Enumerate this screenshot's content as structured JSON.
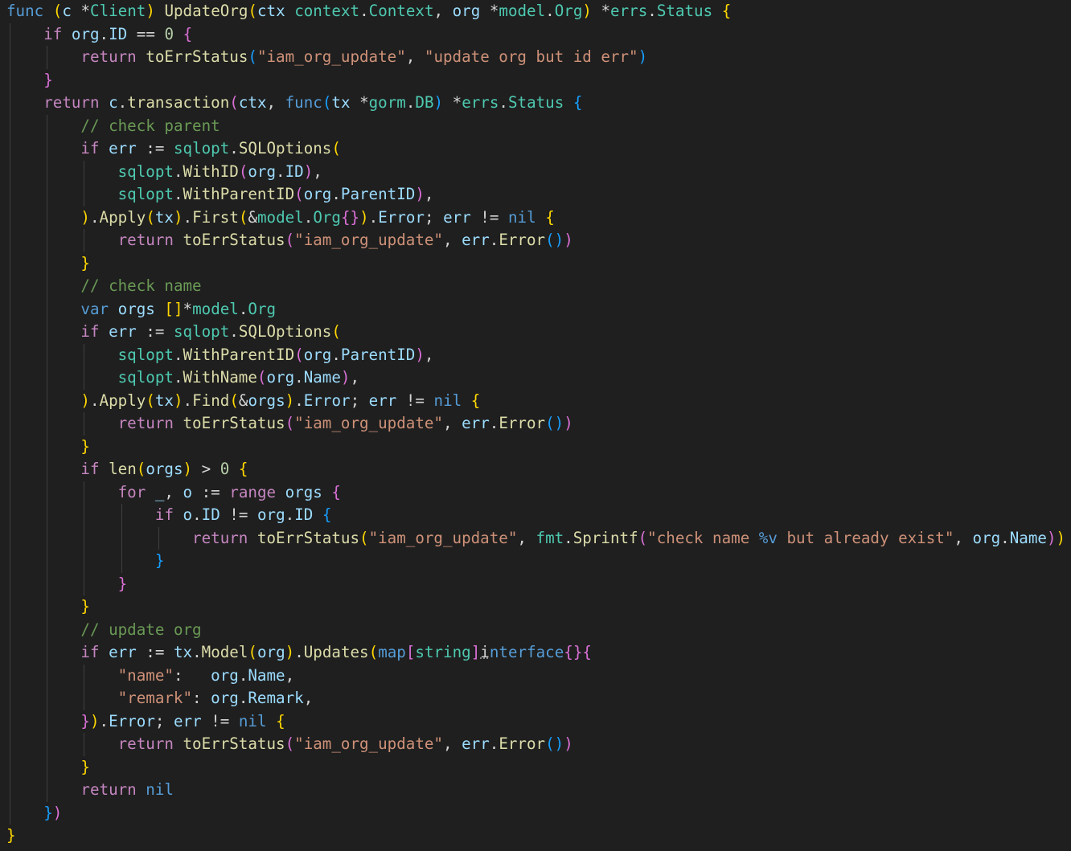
{
  "colors": {
    "background": "#1f1f1f",
    "keyword": "#569cd6",
    "control": "#c586c0",
    "function": "#dcdcaa",
    "type": "#4ec9b0",
    "variable": "#9cdcfe",
    "string": "#ce9178",
    "number": "#b5cea8",
    "comment": "#6a9955",
    "bracket_level_1": "#ffd700",
    "bracket_level_2": "#da70d6",
    "bracket_level_3": "#179fff"
  },
  "code_lines": [
    [
      [
        "kw",
        "func"
      ],
      [
        "op",
        " "
      ],
      [
        "b1",
        "("
      ],
      [
        "var",
        "c"
      ],
      [
        "op",
        " *"
      ],
      [
        "type",
        "Client"
      ],
      [
        "b1",
        ")"
      ],
      [
        "op",
        " "
      ],
      [
        "fn",
        "UpdateOrg"
      ],
      [
        "b1",
        "("
      ],
      [
        "var",
        "ctx"
      ],
      [
        "op",
        " "
      ],
      [
        "type",
        "context"
      ],
      [
        "op",
        "."
      ],
      [
        "type",
        "Context"
      ],
      [
        "op",
        ", "
      ],
      [
        "var",
        "org"
      ],
      [
        "op",
        " *"
      ],
      [
        "type",
        "model"
      ],
      [
        "op",
        "."
      ],
      [
        "type",
        "Org"
      ],
      [
        "b1",
        ")"
      ],
      [
        "op",
        " *"
      ],
      [
        "type",
        "errs"
      ],
      [
        "op",
        "."
      ],
      [
        "type",
        "Status"
      ],
      [
        "op",
        " "
      ],
      [
        "b1",
        "{"
      ]
    ],
    [
      [
        "op",
        "    "
      ],
      [
        "ctrl",
        "if"
      ],
      [
        "op",
        " "
      ],
      [
        "var",
        "org"
      ],
      [
        "op",
        "."
      ],
      [
        "var",
        "ID"
      ],
      [
        "op",
        " == "
      ],
      [
        "num",
        "0"
      ],
      [
        "op",
        " "
      ],
      [
        "b2",
        "{"
      ]
    ],
    [
      [
        "op",
        "        "
      ],
      [
        "ctrl",
        "return"
      ],
      [
        "op",
        " "
      ],
      [
        "fn",
        "toErrStatus"
      ],
      [
        "b3",
        "("
      ],
      [
        "str",
        "\"iam_org_update\""
      ],
      [
        "op",
        ", "
      ],
      [
        "str",
        "\"update org but id err\""
      ],
      [
        "b3",
        ")"
      ]
    ],
    [
      [
        "op",
        "    "
      ],
      [
        "b2",
        "}"
      ]
    ],
    [
      [
        "op",
        "    "
      ],
      [
        "ctrl",
        "return"
      ],
      [
        "op",
        " "
      ],
      [
        "var",
        "c"
      ],
      [
        "op",
        "."
      ],
      [
        "fn",
        "transaction"
      ],
      [
        "b2",
        "("
      ],
      [
        "var",
        "ctx"
      ],
      [
        "op",
        ", "
      ],
      [
        "kw",
        "func"
      ],
      [
        "b3",
        "("
      ],
      [
        "var",
        "tx"
      ],
      [
        "op",
        " *"
      ],
      [
        "type",
        "gorm"
      ],
      [
        "op",
        "."
      ],
      [
        "type",
        "DB"
      ],
      [
        "b3",
        ")"
      ],
      [
        "op",
        " *"
      ],
      [
        "type",
        "errs"
      ],
      [
        "op",
        "."
      ],
      [
        "type",
        "Status"
      ],
      [
        "op",
        " "
      ],
      [
        "b3",
        "{"
      ]
    ],
    [
      [
        "op",
        "        "
      ],
      [
        "com",
        "// check parent"
      ]
    ],
    [
      [
        "op",
        "        "
      ],
      [
        "ctrl",
        "if"
      ],
      [
        "op",
        " "
      ],
      [
        "var",
        "err"
      ],
      [
        "op",
        " := "
      ],
      [
        "type",
        "sqlopt"
      ],
      [
        "op",
        "."
      ],
      [
        "fn",
        "SQLOptions"
      ],
      [
        "b1",
        "("
      ]
    ],
    [
      [
        "op",
        "            "
      ],
      [
        "type",
        "sqlopt"
      ],
      [
        "op",
        "."
      ],
      [
        "fn",
        "WithID"
      ],
      [
        "b2",
        "("
      ],
      [
        "var",
        "org"
      ],
      [
        "op",
        "."
      ],
      [
        "var",
        "ID"
      ],
      [
        "b2",
        ")"
      ],
      [
        "op",
        ","
      ]
    ],
    [
      [
        "op",
        "            "
      ],
      [
        "type",
        "sqlopt"
      ],
      [
        "op",
        "."
      ],
      [
        "fn",
        "WithParentID"
      ],
      [
        "b2",
        "("
      ],
      [
        "var",
        "org"
      ],
      [
        "op",
        "."
      ],
      [
        "var",
        "ParentID"
      ],
      [
        "b2",
        ")"
      ],
      [
        "op",
        ","
      ]
    ],
    [
      [
        "op",
        "        "
      ],
      [
        "b1",
        ")"
      ],
      [
        "op",
        "."
      ],
      [
        "fn",
        "Apply"
      ],
      [
        "b1",
        "("
      ],
      [
        "var",
        "tx"
      ],
      [
        "b1",
        ")"
      ],
      [
        "op",
        "."
      ],
      [
        "fn",
        "First"
      ],
      [
        "b1",
        "("
      ],
      [
        "op",
        "&"
      ],
      [
        "type",
        "model"
      ],
      [
        "op",
        "."
      ],
      [
        "type",
        "Org"
      ],
      [
        "b2",
        "{}"
      ],
      [
        "b1",
        ")"
      ],
      [
        "op",
        "."
      ],
      [
        "var",
        "Error"
      ],
      [
        "op",
        "; "
      ],
      [
        "var",
        "err"
      ],
      [
        "op",
        " != "
      ],
      [
        "kw",
        "nil"
      ],
      [
        "op",
        " "
      ],
      [
        "b1",
        "{"
      ]
    ],
    [
      [
        "op",
        "            "
      ],
      [
        "ctrl",
        "return"
      ],
      [
        "op",
        " "
      ],
      [
        "fn",
        "toErrStatus"
      ],
      [
        "b2",
        "("
      ],
      [
        "str",
        "\"iam_org_update\""
      ],
      [
        "op",
        ", "
      ],
      [
        "var",
        "err"
      ],
      [
        "op",
        "."
      ],
      [
        "fn",
        "Error"
      ],
      [
        "b3",
        "()"
      ],
      [
        "b2",
        ")"
      ]
    ],
    [
      [
        "op",
        "        "
      ],
      [
        "b1",
        "}"
      ]
    ],
    [
      [
        "op",
        "        "
      ],
      [
        "com",
        "// check name"
      ]
    ],
    [
      [
        "op",
        "        "
      ],
      [
        "kw",
        "var"
      ],
      [
        "op",
        " "
      ],
      [
        "var",
        "orgs"
      ],
      [
        "op",
        " "
      ],
      [
        "b1",
        "[]"
      ],
      [
        "op",
        "*"
      ],
      [
        "type",
        "model"
      ],
      [
        "op",
        "."
      ],
      [
        "type",
        "Org"
      ]
    ],
    [
      [
        "op",
        "        "
      ],
      [
        "ctrl",
        "if"
      ],
      [
        "op",
        " "
      ],
      [
        "var",
        "err"
      ],
      [
        "op",
        " := "
      ],
      [
        "type",
        "sqlopt"
      ],
      [
        "op",
        "."
      ],
      [
        "fn",
        "SQLOptions"
      ],
      [
        "b1",
        "("
      ]
    ],
    [
      [
        "op",
        "            "
      ],
      [
        "type",
        "sqlopt"
      ],
      [
        "op",
        "."
      ],
      [
        "fn",
        "WithParentID"
      ],
      [
        "b2",
        "("
      ],
      [
        "var",
        "org"
      ],
      [
        "op",
        "."
      ],
      [
        "var",
        "ParentID"
      ],
      [
        "b2",
        ")"
      ],
      [
        "op",
        ","
      ]
    ],
    [
      [
        "op",
        "            "
      ],
      [
        "type",
        "sqlopt"
      ],
      [
        "op",
        "."
      ],
      [
        "fn",
        "WithName"
      ],
      [
        "b2",
        "("
      ],
      [
        "var",
        "org"
      ],
      [
        "op",
        "."
      ],
      [
        "var",
        "Name"
      ],
      [
        "b2",
        ")"
      ],
      [
        "op",
        ","
      ]
    ],
    [
      [
        "op",
        "        "
      ],
      [
        "b1",
        ")"
      ],
      [
        "op",
        "."
      ],
      [
        "fn",
        "Apply"
      ],
      [
        "b1",
        "("
      ],
      [
        "var",
        "tx"
      ],
      [
        "b1",
        ")"
      ],
      [
        "op",
        "."
      ],
      [
        "fn",
        "Find"
      ],
      [
        "b1",
        "("
      ],
      [
        "op",
        "&"
      ],
      [
        "var",
        "orgs"
      ],
      [
        "b1",
        ")"
      ],
      [
        "op",
        "."
      ],
      [
        "var",
        "Error"
      ],
      [
        "op",
        "; "
      ],
      [
        "var",
        "err"
      ],
      [
        "op",
        " != "
      ],
      [
        "kw",
        "nil"
      ],
      [
        "op",
        " "
      ],
      [
        "b1",
        "{"
      ]
    ],
    [
      [
        "op",
        "            "
      ],
      [
        "ctrl",
        "return"
      ],
      [
        "op",
        " "
      ],
      [
        "fn",
        "toErrStatus"
      ],
      [
        "b2",
        "("
      ],
      [
        "str",
        "\"iam_org_update\""
      ],
      [
        "op",
        ", "
      ],
      [
        "var",
        "err"
      ],
      [
        "op",
        "."
      ],
      [
        "fn",
        "Error"
      ],
      [
        "b3",
        "()"
      ],
      [
        "b2",
        ")"
      ]
    ],
    [
      [
        "op",
        "        "
      ],
      [
        "b1",
        "}"
      ]
    ],
    [
      [
        "op",
        "        "
      ],
      [
        "ctrl",
        "if"
      ],
      [
        "op",
        " "
      ],
      [
        "fn",
        "len"
      ],
      [
        "b1",
        "("
      ],
      [
        "var",
        "orgs"
      ],
      [
        "b1",
        ")"
      ],
      [
        "op",
        " > "
      ],
      [
        "num",
        "0"
      ],
      [
        "op",
        " "
      ],
      [
        "b1",
        "{"
      ]
    ],
    [
      [
        "op",
        "            "
      ],
      [
        "ctrl",
        "for"
      ],
      [
        "op",
        " "
      ],
      [
        "var",
        "_"
      ],
      [
        "op",
        ", "
      ],
      [
        "var",
        "o"
      ],
      [
        "op",
        " := "
      ],
      [
        "ctrl",
        "range"
      ],
      [
        "op",
        " "
      ],
      [
        "var",
        "orgs"
      ],
      [
        "op",
        " "
      ],
      [
        "b2",
        "{"
      ]
    ],
    [
      [
        "op",
        "                "
      ],
      [
        "ctrl",
        "if"
      ],
      [
        "op",
        " "
      ],
      [
        "var",
        "o"
      ],
      [
        "op",
        "."
      ],
      [
        "var",
        "ID"
      ],
      [
        "op",
        " != "
      ],
      [
        "var",
        "org"
      ],
      [
        "op",
        "."
      ],
      [
        "var",
        "ID"
      ],
      [
        "op",
        " "
      ],
      [
        "b3",
        "{"
      ]
    ],
    [
      [
        "op",
        "                    "
      ],
      [
        "ctrl",
        "return"
      ],
      [
        "op",
        " "
      ],
      [
        "fn",
        "toErrStatus"
      ],
      [
        "b1",
        "("
      ],
      [
        "str",
        "\"iam_org_update\""
      ],
      [
        "op",
        ", "
      ],
      [
        "type",
        "fmt"
      ],
      [
        "op",
        "."
      ],
      [
        "fn",
        "Sprintf"
      ],
      [
        "b2",
        "("
      ],
      [
        "str",
        "\"check name "
      ],
      [
        "kw",
        "%v"
      ],
      [
        "str",
        " but already exist\""
      ],
      [
        "op",
        ", "
      ],
      [
        "var",
        "org"
      ],
      [
        "op",
        "."
      ],
      [
        "var",
        "Name"
      ],
      [
        "b2",
        ")"
      ],
      [
        "b1",
        ")"
      ]
    ],
    [
      [
        "op",
        "                "
      ],
      [
        "b3",
        "}"
      ]
    ],
    [
      [
        "op",
        "            "
      ],
      [
        "b2",
        "}"
      ]
    ],
    [
      [
        "op",
        "        "
      ],
      [
        "b1",
        "}"
      ]
    ],
    [
      [
        "op",
        "        "
      ],
      [
        "com",
        "// update org"
      ]
    ],
    [
      [
        "op",
        "        "
      ],
      [
        "ctrl",
        "if"
      ],
      [
        "op",
        " "
      ],
      [
        "var",
        "err"
      ],
      [
        "op",
        " := "
      ],
      [
        "var",
        "tx"
      ],
      [
        "op",
        "."
      ],
      [
        "fn",
        "Model"
      ],
      [
        "b1",
        "("
      ],
      [
        "var",
        "org"
      ],
      [
        "b1",
        ")"
      ],
      [
        "op",
        "."
      ],
      [
        "fn",
        "Updates"
      ],
      [
        "b1",
        "("
      ],
      [
        "kw",
        "map"
      ],
      [
        "b2",
        "["
      ],
      [
        "type",
        "string"
      ],
      [
        "b2",
        "]"
      ],
      [
        "wav",
        "i"
      ],
      [
        "kw",
        "nterface"
      ],
      [
        "b2",
        "{}"
      ],
      [
        "b2",
        "{"
      ]
    ],
    [
      [
        "op",
        "            "
      ],
      [
        "str",
        "\"name\""
      ],
      [
        "op",
        ":   "
      ],
      [
        "var",
        "org"
      ],
      [
        "op",
        "."
      ],
      [
        "var",
        "Name"
      ],
      [
        "op",
        ","
      ]
    ],
    [
      [
        "op",
        "            "
      ],
      [
        "str",
        "\"remark\""
      ],
      [
        "op",
        ": "
      ],
      [
        "var",
        "org"
      ],
      [
        "op",
        "."
      ],
      [
        "var",
        "Remark"
      ],
      [
        "op",
        ","
      ]
    ],
    [
      [
        "op",
        "        "
      ],
      [
        "b2",
        "}"
      ],
      [
        "b1",
        ")"
      ],
      [
        "op",
        "."
      ],
      [
        "var",
        "Error"
      ],
      [
        "op",
        "; "
      ],
      [
        "var",
        "err"
      ],
      [
        "op",
        " != "
      ],
      [
        "kw",
        "nil"
      ],
      [
        "op",
        " "
      ],
      [
        "b1",
        "{"
      ]
    ],
    [
      [
        "op",
        "            "
      ],
      [
        "ctrl",
        "return"
      ],
      [
        "op",
        " "
      ],
      [
        "fn",
        "toErrStatus"
      ],
      [
        "b2",
        "("
      ],
      [
        "str",
        "\"iam_org_update\""
      ],
      [
        "op",
        ", "
      ],
      [
        "var",
        "err"
      ],
      [
        "op",
        "."
      ],
      [
        "fn",
        "Error"
      ],
      [
        "b3",
        "()"
      ],
      [
        "b2",
        ")"
      ]
    ],
    [
      [
        "op",
        "        "
      ],
      [
        "b1",
        "}"
      ]
    ],
    [
      [
        "op",
        "        "
      ],
      [
        "ctrl",
        "return"
      ],
      [
        "op",
        " "
      ],
      [
        "kw",
        "nil"
      ]
    ],
    [
      [
        "op",
        "    "
      ],
      [
        "b3",
        "}"
      ],
      [
        "b2",
        ")"
      ]
    ],
    [
      [
        "b1",
        "}"
      ]
    ]
  ]
}
